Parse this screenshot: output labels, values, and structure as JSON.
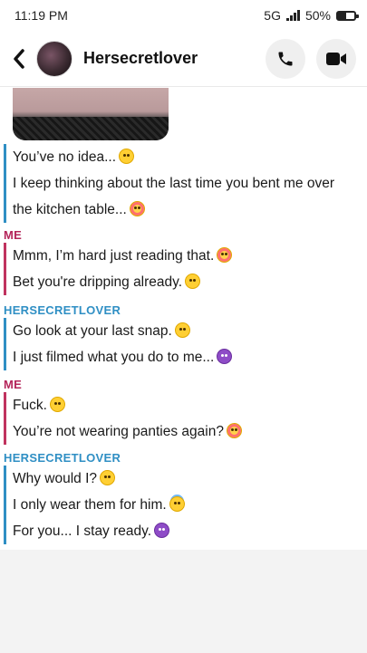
{
  "status": {
    "time": "11:19 PM",
    "network": "5G",
    "battery": "50%",
    "battery_level": 0.5
  },
  "header": {
    "contact_name": "Hersecretlover",
    "back_icon": "chevron-left-icon",
    "call_icon": "phone-icon",
    "video_icon": "video-camera-icon"
  },
  "conversation": [
    {
      "sender": "",
      "side": "her",
      "messages": [
        {
          "text": "You’ve no idea...",
          "emoji": "smirk"
        },
        {
          "text": "I keep thinking about the last time you bent me over",
          "emoji": ""
        },
        {
          "text": "the kitchen table...",
          "emoji": "flushed"
        }
      ]
    },
    {
      "sender": "ME",
      "side": "me",
      "messages": [
        {
          "text": "Mmm, I’m hard just reading that.",
          "emoji": "flushed"
        },
        {
          "text": "Bet you're dripping already.",
          "emoji": "smirk"
        }
      ]
    },
    {
      "sender": "HERSECRETLOVER",
      "side": "her",
      "messages": [
        {
          "text": "Go look at your last snap.",
          "emoji": "smirk"
        },
        {
          "text": "I just filmed what you do to me...",
          "emoji": "smiling-devil"
        }
      ]
    },
    {
      "sender": "ME",
      "side": "me",
      "messages": [
        {
          "text": "Fuck.",
          "emoji": "astonished"
        },
        {
          "text": "You’re not wearing panties again?",
          "emoji": "flushed"
        }
      ]
    },
    {
      "sender": "HERSECRETLOVER",
      "side": "her",
      "messages": [
        {
          "text": "Why would I?",
          "emoji": "thinking"
        },
        {
          "text": "I only wear them for him.",
          "emoji": "halo"
        },
        {
          "text": "For you... I stay ready.",
          "emoji": "smiling-devil"
        }
      ]
    }
  ]
}
